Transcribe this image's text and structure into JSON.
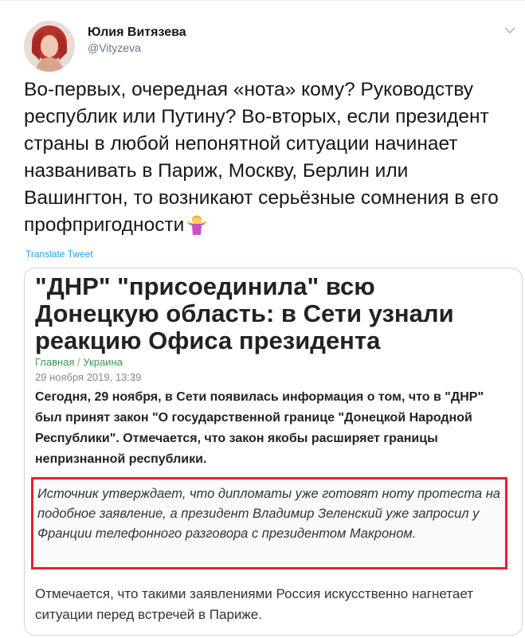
{
  "author": {
    "name": "Юлия Витязева",
    "handle": "@Vityzeva"
  },
  "tweet": {
    "text": "Во-первых, очередная «нота» кому? Руководству республик или Путину? Во-вторых, если президент страны в любой непонятной ситуации начинает названивать в Париж, Москву, Берлин или Вашингтон, то возникают серьёзные сомнения в его профпригодности",
    "emoji": "person-shrugging-emoji"
  },
  "translate_label": "Translate Tweet",
  "article": {
    "headline": "\"ДНР\" \"присоединила\" всю Донецкую область: в Сети узнали реакцию Офиса президента",
    "breadcrumb": [
      "Главная",
      "Украина"
    ],
    "breadcrumb_sep": "/",
    "date": "29 ноября 2019, 13:39",
    "lead": "Сегодня, 29 ноября, в Сети появилась информация о том, что в \"ДНР\" был принят закон \"О государственной границе \"Донецкой Народной Республики\". Отмечается, что закон якобы расширяет границы непризнанной республики.",
    "quote": "Источник утверждает, что дипломаты уже готовят ноту протеста на подобное заявление, а президент Владимир Зеленский уже запросил у Франции телефонного разговора с президентом Макроном.",
    "paragraph": "Отмечается, что такими заявлениями Россия искусственно нагнетает ситуации перед встречей в Париже.",
    "highlight_color": "#e52031",
    "breadcrumb_color": "#3a9a4a"
  },
  "colors": {
    "link": "#1da1f2",
    "secondary_text": "#657786"
  }
}
